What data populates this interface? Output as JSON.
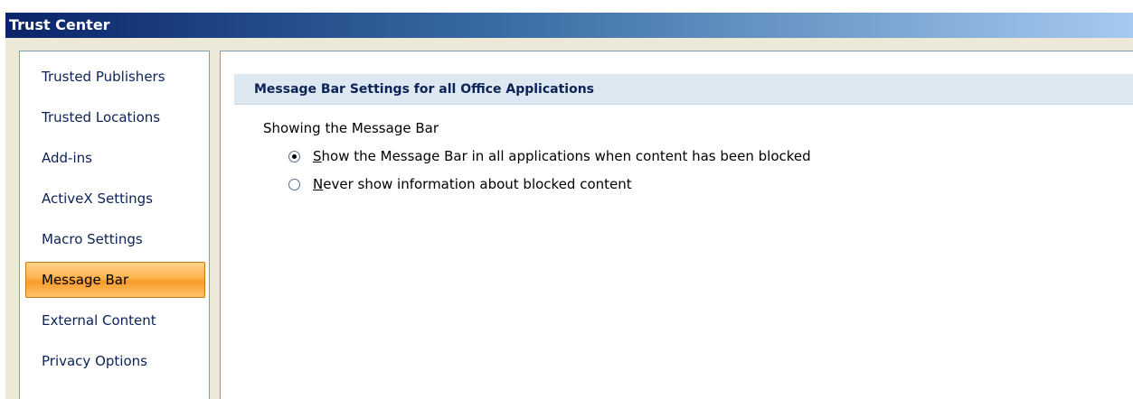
{
  "window": {
    "title": "Trust Center"
  },
  "sidebar": {
    "items": [
      {
        "label": "Trusted Publishers"
      },
      {
        "label": "Trusted Locations"
      },
      {
        "label": "Add-ins"
      },
      {
        "label": "ActiveX Settings"
      },
      {
        "label": "Macro Settings"
      },
      {
        "label": "Message Bar",
        "selected": true
      },
      {
        "label": "External Content"
      },
      {
        "label": "Privacy Options"
      }
    ]
  },
  "main": {
    "section_title": "Message Bar Settings for all Office Applications",
    "group_label": "Showing the Message Bar",
    "options": [
      {
        "accel": "S",
        "rest": "how the Message Bar in all applications when content has been blocked",
        "checked": true
      },
      {
        "accel": "N",
        "rest": "ever show information about blocked content",
        "checked": false
      }
    ]
  },
  "colors": {
    "accent_selected": "#ffb34d",
    "title_bar": "#0a246a",
    "section_header_bg": "#dde8f3"
  }
}
